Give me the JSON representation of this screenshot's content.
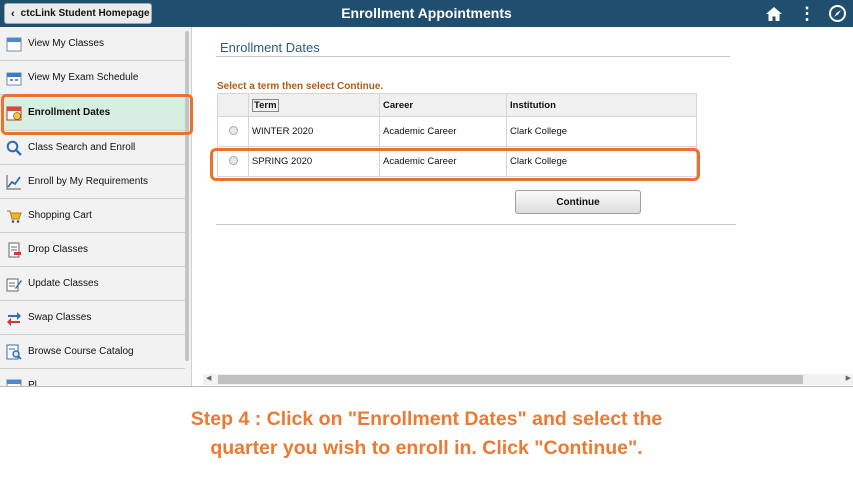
{
  "header": {
    "back_label": "ctcLink Student Homepage",
    "title": "Enrollment Appointments",
    "icons": [
      "chevron-left-icon",
      "home-icon",
      "kebab-menu-icon",
      "navbar-compass-icon"
    ],
    "background": "#1f4e6e"
  },
  "sidebar": {
    "items": [
      {
        "label": "View My Classes",
        "icon": "calendar-icon"
      },
      {
        "label": "View My Exam Schedule",
        "icon": "exam-calendar-icon"
      },
      {
        "label": "Enrollment Dates",
        "icon": "calendar-clock-icon",
        "active": true
      },
      {
        "label": "Class Search and Enroll",
        "icon": "search-icon"
      },
      {
        "label": "Enroll by My Requirements",
        "icon": "chart-line-icon"
      },
      {
        "label": "Shopping Cart",
        "icon": "shopping-cart-icon"
      },
      {
        "label": "Drop Classes",
        "icon": "drop-document-icon"
      },
      {
        "label": "Update Classes",
        "icon": "edit-document-icon"
      },
      {
        "label": "Swap Classes",
        "icon": "swap-arrows-icon"
      },
      {
        "label": "Browse Course Catalog",
        "icon": "catalog-search-icon"
      },
      {
        "label": "Pl",
        "icon": "planner-icon"
      }
    ],
    "active_color": "#d6efe0"
  },
  "main": {
    "section_title": "Enrollment Dates",
    "instruction": "Select a term then select Continue.",
    "table": {
      "headers": [
        "Term",
        "Career",
        "Institution"
      ],
      "rows": [
        {
          "term": "WINTER 2020",
          "career": "Academic Career",
          "institution": "Clark College"
        },
        {
          "term": "SPRING 2020",
          "career": "Academic Career",
          "institution": "Clark College"
        }
      ]
    },
    "continue_label": "Continue"
  },
  "caption": {
    "line1": "Step 4 : Click on \"Enrollment Dates\" and select the",
    "line2": "quarter you wish to enroll in. Click \"Continue\".",
    "color": "#ec7a33"
  },
  "highlight_color": "#ec7030"
}
